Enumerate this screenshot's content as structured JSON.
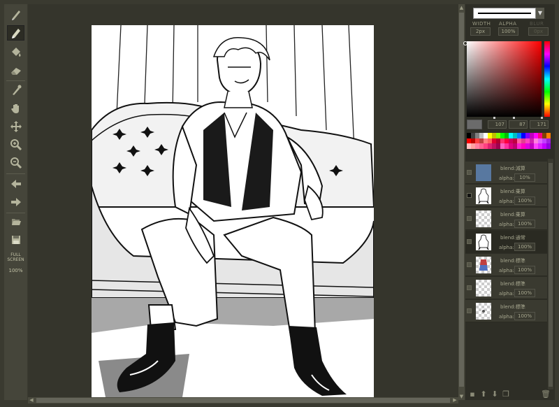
{
  "toolbar": {
    "tools": [
      {
        "name": "pen-tool",
        "icon": "pen-icon"
      },
      {
        "name": "pencil-tool",
        "icon": "pencil-icon",
        "active": true
      },
      {
        "name": "bucket-tool",
        "icon": "paint-bucket-icon"
      },
      {
        "name": "eraser-tool",
        "icon": "eraser-icon"
      },
      {
        "name": "eyedropper-tool",
        "icon": "eyedropper-icon"
      },
      {
        "name": "hand-tool",
        "icon": "hand-icon"
      },
      {
        "name": "move-tool",
        "icon": "move-icon"
      },
      {
        "name": "zoom-in-tool",
        "icon": "zoom-in-icon"
      },
      {
        "name": "zoom-out-tool",
        "icon": "zoom-out-icon"
      },
      {
        "name": "undo-tool",
        "icon": "undo-arrow-icon"
      },
      {
        "name": "redo-tool",
        "icon": "redo-arrow-icon"
      },
      {
        "name": "open-tool",
        "icon": "open-file-icon"
      },
      {
        "name": "save-tool",
        "icon": "save-icon"
      }
    ],
    "fullscreen_line1": "FULL",
    "fullscreen_line2": "SCREEN",
    "zoom_level": "100%"
  },
  "brush": {
    "width_label": "WIDTH",
    "width_value": "2px",
    "alpha_label": "ALPHA",
    "alpha_value": "100%",
    "blur_label": "BLUR",
    "blur_value": "0px"
  },
  "color": {
    "current": "#6b6b6b",
    "hue": "#ff0000",
    "r": "107",
    "g": "87",
    "b": "171"
  },
  "palette": [
    "#000000",
    "#404040",
    "#808080",
    "#c0c0c0",
    "#ffffff",
    "#ffff00",
    "#c0c000",
    "#80ff00",
    "#00ff00",
    "#00c000",
    "#00ffff",
    "#00c0c0",
    "#0080ff",
    "#0000ff",
    "#8000ff",
    "#c000c0",
    "#ff00ff",
    "#ff0080",
    "#804000",
    "#ff8000",
    "#ff0000",
    "#c00000",
    "#ff4040",
    "#c04040",
    "#ff8080",
    "#ff6060",
    "#e00030",
    "#b00030",
    "#ff3070",
    "#ff0040",
    "#d00060",
    "#c00040",
    "#ff60a0",
    "#e04090",
    "#ff40c0",
    "#d020b0",
    "#ff80e0",
    "#e060ff",
    "#c040ff",
    "#a020e0",
    "#ffc0c0",
    "#ffa0a0",
    "#ff80a0",
    "#ff6090",
    "#ff4080",
    "#e02070",
    "#c01060",
    "#a00050",
    "#ff60c0",
    "#ff30a0",
    "#e00080",
    "#c00070",
    "#ff20d0",
    "#ff00c0",
    "#e000e0",
    "#c000c0",
    "#ff40ff",
    "#e020ff",
    "#c000ff",
    "#9000e0"
  ],
  "layers": [
    {
      "blend": "blend:減算",
      "alpha_label": "alpha:",
      "alpha": "10%",
      "visible": false,
      "thumb": "blue"
    },
    {
      "blend": "blend:乗算",
      "alpha_label": "alpha:",
      "alpha": "100%",
      "visible": true,
      "thumb": "figure"
    },
    {
      "blend": "blend:乗算",
      "alpha_label": "alpha:",
      "alpha": "100%",
      "visible": false,
      "thumb": "empty"
    },
    {
      "blend": "blend:通常",
      "alpha_label": "alpha:",
      "alpha": "100%",
      "visible": false,
      "selected": true,
      "thumb": "sketch"
    },
    {
      "blend": "blend:標準",
      "alpha_label": "alpha:",
      "alpha": "100%",
      "visible": false,
      "thumb": "color"
    },
    {
      "blend": "blend:標準",
      "alpha_label": "alpha:",
      "alpha": "100%",
      "visible": false,
      "thumb": "empty"
    },
    {
      "blend": "blend:標準",
      "alpha_label": "alpha:",
      "alpha": "100%",
      "visible": false,
      "thumb": "dot"
    }
  ],
  "layer_actions": [
    "new-layer-icon",
    "move-up-icon",
    "move-down-icon",
    "duplicate-layer-icon",
    "trash-icon"
  ]
}
